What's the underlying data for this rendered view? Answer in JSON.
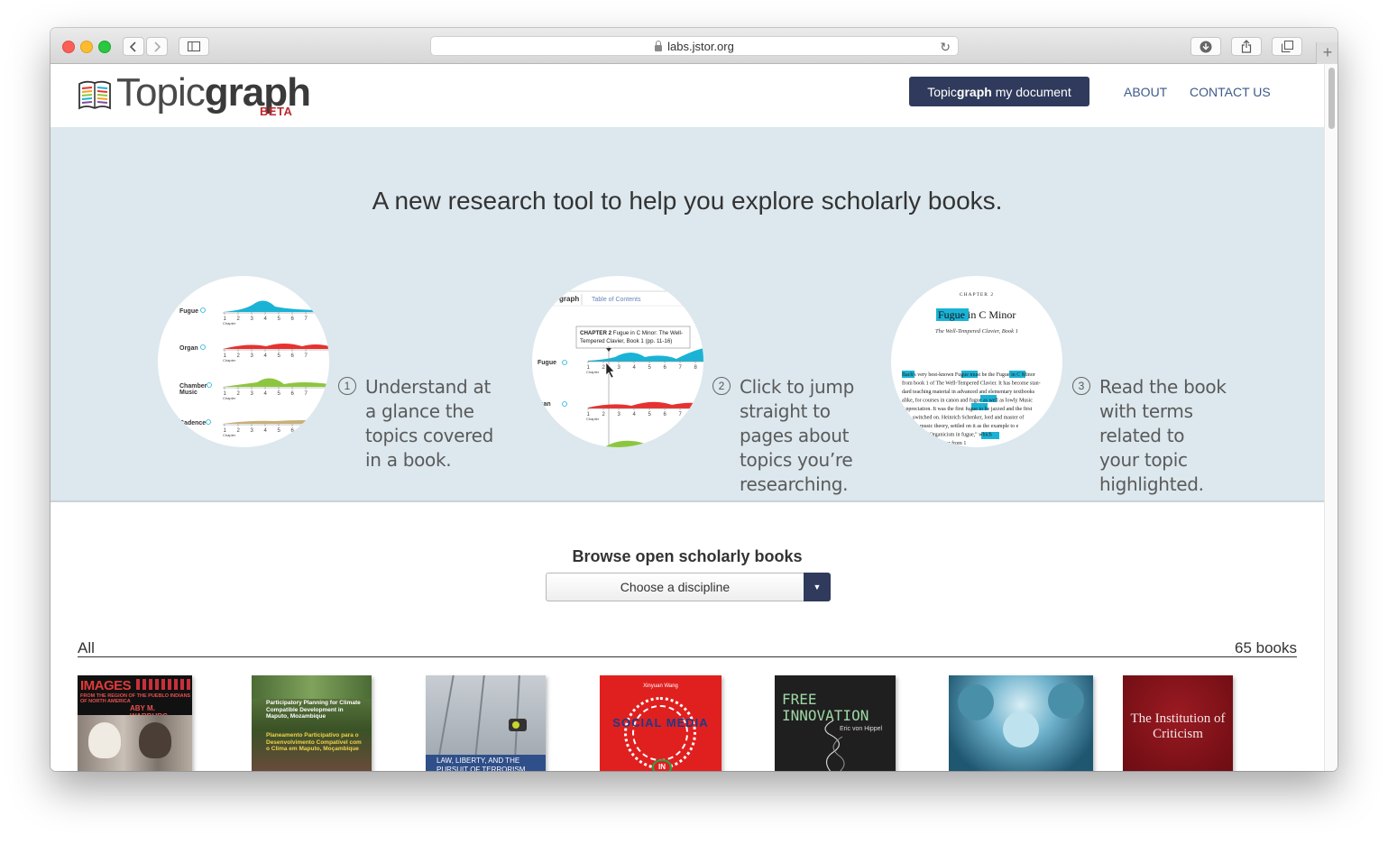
{
  "browser": {
    "url": "labs.jstor.org"
  },
  "header": {
    "logo_light": "Topic",
    "logo_bold": "graph",
    "logo_badge": "BETA",
    "cta_light": "Topic",
    "cta_bold": "graph",
    "cta_rest": " my document",
    "nav": [
      "ABOUT",
      "CONTACT US"
    ]
  },
  "hero": {
    "title": "A new research tool to help you explore scholarly books.",
    "steps": [
      {
        "number": "1",
        "lines": [
          "Understand at",
          "a glance the",
          "topics covered",
          "in a book."
        ]
      },
      {
        "number": "2",
        "lines": [
          "Click to jump",
          "straight to",
          "pages about",
          "topics you’re",
          "researching."
        ]
      },
      {
        "number": "3",
        "lines": [
          "Read the book",
          "with terms",
          "related to",
          "your topic",
          "highlighted."
        ]
      }
    ],
    "illustration1": {
      "topics": [
        "Fugue",
        "Organ",
        "Chamber Music",
        "Cadence"
      ],
      "ticks": [
        "1",
        "2",
        "3",
        "4",
        "5",
        "6",
        "7"
      ],
      "axis": "Chapter",
      "colors": [
        "#1ab3d6",
        "#e8312f",
        "#8cc63f",
        "#c8b07a"
      ]
    },
    "illustration2": {
      "tab": "Table of Contents",
      "brand": "graph",
      "tooltip_bold": "CHAPTER 2",
      "tooltip_text": "Fugue in C Minor: The Well-Tempered Clavier, Book 1 (pp. 11-16)",
      "topics": [
        "Fugue",
        "Organ"
      ],
      "ticks": [
        "1",
        "2",
        "3",
        "4",
        "5",
        "6",
        "7",
        "8"
      ],
      "axis": "Chapter"
    },
    "illustration3": {
      "chapter": "CHAPTER 2",
      "heading_hl": "Fugue",
      "heading_rest": " in C Minor",
      "subheading": "The Well-Tempered Clavier, Book 1",
      "body": [
        "Bach's very best-known Fugue must be the Fugue in C Minor",
        "from book 1 of The Well-Tempered Clavier. It has become stan-",
        "dard teaching material in advanced and elementary textbooks",
        "alike, for courses in canon and fugue as well as lowly Music",
        "Appreciation. It was the first fugue to be jazzed and the first",
        "switched on. Heinrich Schenker, lord and master of",
        "music theory, settled on it as the example to e",
        "\"Organicism in fugue,\" which",
        "chapter from 1"
      ]
    }
  },
  "browse": {
    "title": "Browse open scholarly books",
    "select_value": "Choose a discipline",
    "filter_label": "All",
    "count_label": "65 books"
  },
  "books": [
    {
      "title": "IMAGES",
      "subtitle": "FROM THE REGION OF THE PUEBLO INDIANS OF NORTH AMERICA",
      "author": "ABY M. WARBURG",
      "bg": "#1a1a1a"
    },
    {
      "title": "Participatory Planning for Climate Compatible Development in Maputo, Mozambique",
      "subtitle": "Planeamento Participativo para o Desenvolvimento Compatível com o Clima em Maputo, Moçambique",
      "bg": "#3d5a2a"
    },
    {
      "title": "LAW, LIBERTY, AND THE PURSUIT OF TERRORISM",
      "bg": "#b7bcc2"
    },
    {
      "title": "SOCIAL MEDIA",
      "author": "Xinyuan Wang",
      "small": "IN",
      "bg": "#e0201f"
    },
    {
      "title": "FREE INNOVATION",
      "author": "Eric von Hippel",
      "bg": "#1f1f1f"
    },
    {
      "title": "",
      "bg": "#2e6f8f"
    },
    {
      "title": "The Institution of Criticism",
      "bg": "#7a1016"
    }
  ]
}
